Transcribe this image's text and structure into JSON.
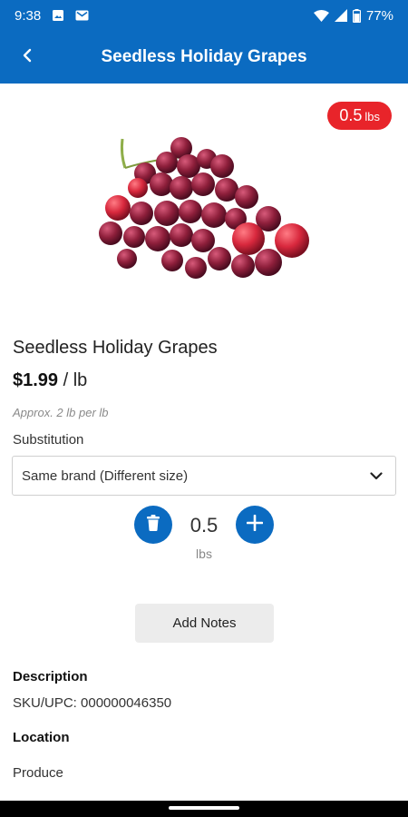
{
  "status_bar": {
    "time": "9:38",
    "battery": "77%",
    "icons": [
      "image-icon",
      "gmail-icon",
      "wifi-icon",
      "signal-icon",
      "battery-icon"
    ]
  },
  "app_bar": {
    "title": "Seedless Holiday Grapes",
    "back_icon": "chevron-left-icon"
  },
  "badge": {
    "quantity": "0.5",
    "unit": "lbs",
    "color": "#e8242a"
  },
  "product": {
    "name": "Seedless Holiday Grapes",
    "price": "$1.99",
    "price_unit": "/ lb",
    "approx": "Approx. 2 lb per lb"
  },
  "substitution": {
    "label": "Substitution",
    "selected": "Same brand (Different size)"
  },
  "stepper": {
    "value": "0.5",
    "unit": "lbs"
  },
  "actions": {
    "add_notes": "Add Notes"
  },
  "description": {
    "title": "Description",
    "text": "SKU/UPC: 000000046350"
  },
  "location": {
    "title": "Location",
    "text": "Produce"
  },
  "colors": {
    "primary": "#0b6bc1",
    "badge": "#e8242a"
  }
}
